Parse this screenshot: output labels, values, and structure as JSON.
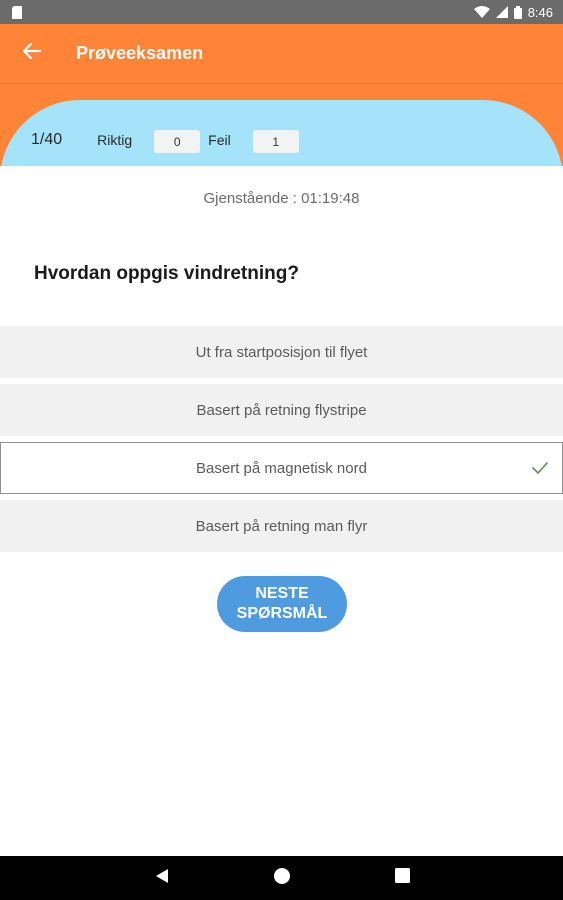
{
  "status_bar": {
    "time": "8:46",
    "icons": [
      "sd-card-icon",
      "wifi-icon",
      "signal-icon",
      "battery-icon"
    ]
  },
  "app_bar": {
    "title": "Prøveeksamen",
    "back_icon": "arrow-back-icon"
  },
  "score": {
    "progress": "1/40",
    "correct_label": "Riktig",
    "correct_value": "0",
    "wrong_label": "Feil",
    "wrong_value": "1"
  },
  "timer": {
    "text": "Gjenstående : 01:19:48"
  },
  "question": {
    "text": "Hvordan oppgis vindretning?"
  },
  "options": [
    {
      "label": "Ut fra startposisjon til flyet",
      "selected": false
    },
    {
      "label": "Basert på retning flystripe",
      "selected": false
    },
    {
      "label": "Basert på magnetisk nord",
      "selected": true
    },
    {
      "label": "Basert på retning man flyr",
      "selected": false
    }
  ],
  "next_button": {
    "line1": "NESTE",
    "line2": "SPØRSMÅL"
  },
  "nav_bar": {
    "icons": [
      "back-triangle-icon",
      "home-circle-icon",
      "recents-square-icon"
    ]
  },
  "colors": {
    "app_bar": "#ff8437",
    "score_panel": "#a5e3fb",
    "next_button": "#4f9be0",
    "status_bar": "#6b6b6b",
    "check": "#6a8a5a"
  }
}
